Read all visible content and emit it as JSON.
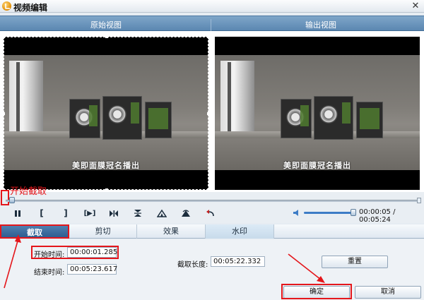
{
  "window": {
    "title": "视频编辑",
    "close_glyph": "✕"
  },
  "views": {
    "original_label": "原始视图",
    "output_label": "输出视图"
  },
  "preview": {
    "caption": "美即面膜冠名播出"
  },
  "annotation": {
    "start_cut_label": "开始截取",
    "color": "#e4161b"
  },
  "playback": {
    "buttons": [
      {
        "icon": "pause-icon"
      },
      {
        "icon": "mark-in-bracket-icon",
        "text": "["
      },
      {
        "icon": "mark-out-bracket-icon",
        "text": "]"
      },
      {
        "icon": "play-selection-icon",
        "text": "[▶]"
      },
      {
        "icon": "skip-to-marker-icon"
      },
      {
        "icon": "flip-vertical-icon"
      },
      {
        "icon": "rotate-left-icon"
      },
      {
        "icon": "rotate-right-icon"
      },
      {
        "icon": "undo-icon"
      }
    ],
    "time": "00:00:05 / 00:05:24",
    "volume_level": 0.95
  },
  "tabs": [
    {
      "label": "截取",
      "active": true
    },
    {
      "label": "剪切",
      "active": false
    },
    {
      "label": "效果",
      "active": false
    },
    {
      "label": "水印",
      "active": false
    }
  ],
  "form": {
    "start_label": "开始时间:",
    "start_value": "00:00:01.285",
    "end_label": "结束时间:",
    "end_value": "00:05:23.617",
    "length_label": "截取长度:",
    "length_value": "00:05:22.332",
    "reset_label": "重置",
    "ok_label": "确定",
    "cancel_label": "取消"
  },
  "colors": {
    "header_blue": "#5b87b1",
    "tab_active": "#2f5e90",
    "accent_red": "#e4161b"
  }
}
